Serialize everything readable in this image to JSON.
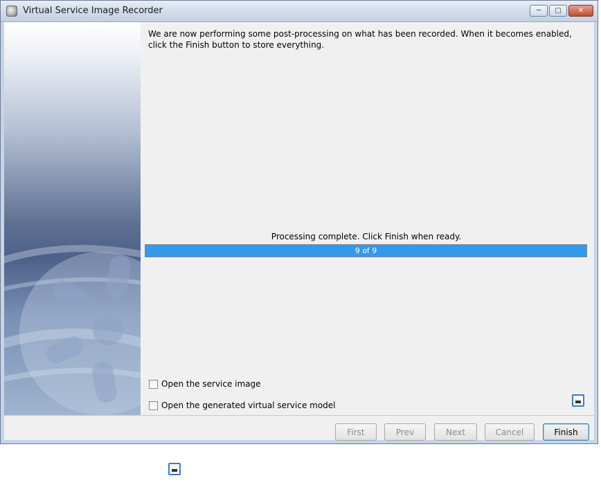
{
  "window": {
    "title": "Virtual Service Image Recorder",
    "icon": "recorder-app-icon",
    "controls": [
      "minimize-icon",
      "maximize-icon",
      "close-icon"
    ]
  },
  "main": {
    "message": "We are now performing some post-processing on what has been recorded.  When it becomes enabled, click the Finish button to store everything.",
    "progress": {
      "label": "Processing complete.  Click Finish when ready.",
      "text": "9 of 9",
      "current": 9,
      "total": 9,
      "fraction": 1.0,
      "fill_color": "#3399ee"
    },
    "options": [
      {
        "label": "Open the service image",
        "checked": false
      },
      {
        "label": "Open the generated virtual service model",
        "checked": false
      }
    ]
  },
  "footer": {
    "buttons": {
      "first": "First",
      "prev": "Prev",
      "next": "Next",
      "cancel": "Cancel",
      "finish": "Finish"
    },
    "enabled": {
      "first": false,
      "prev": false,
      "next": false,
      "cancel": false,
      "finish": true
    }
  },
  "colors": {
    "accent": "#3399ee",
    "disabled_text": "#8d8d8d"
  }
}
